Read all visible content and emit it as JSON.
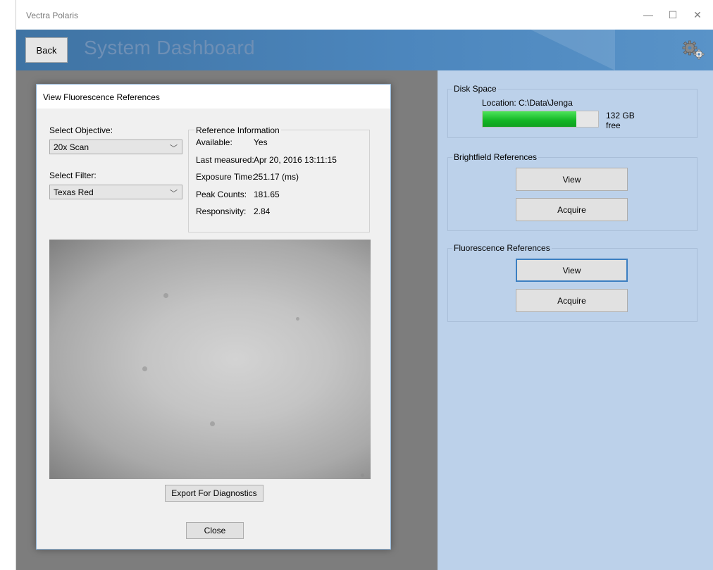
{
  "window": {
    "title": "Vectra Polaris",
    "controls": {
      "minimize": "—",
      "maximize": "☐",
      "close": "✕"
    }
  },
  "header": {
    "back_label": "Back",
    "title": "System Dashboard"
  },
  "dialog": {
    "title": "View Fluorescence References",
    "objective_label": "Select Objective:",
    "objective_value": "20x Scan",
    "filter_label": "Select Filter:",
    "filter_value": "Texas Red",
    "reference_info": {
      "title": "Reference Information",
      "rows": [
        {
          "label": "Available:",
          "value": "Yes"
        },
        {
          "label": "Last measured:",
          "value": "Apr 20, 2016 13:11:15"
        },
        {
          "label": "Exposure Time:",
          "value": "251.17 (ms)"
        },
        {
          "label": "Peak Counts:",
          "value": "181.65"
        },
        {
          "label": "Responsivity:",
          "value": "2.84"
        }
      ]
    },
    "export_label": "Export For Diagnostics",
    "close_label": "Close"
  },
  "disk_space": {
    "title": "Disk Space",
    "location": "Location: C:\\Data\\Jenga",
    "free_amount": "132 GB",
    "free_label": "free",
    "used_fraction": 0.81,
    "bar_color": "#1fbf2f"
  },
  "brightfield": {
    "title": "Brightfield References",
    "view_label": "View",
    "acquire_label": "Acquire"
  },
  "fluorescence": {
    "title": "Fluorescence References",
    "view_label": "View",
    "acquire_label": "Acquire"
  }
}
